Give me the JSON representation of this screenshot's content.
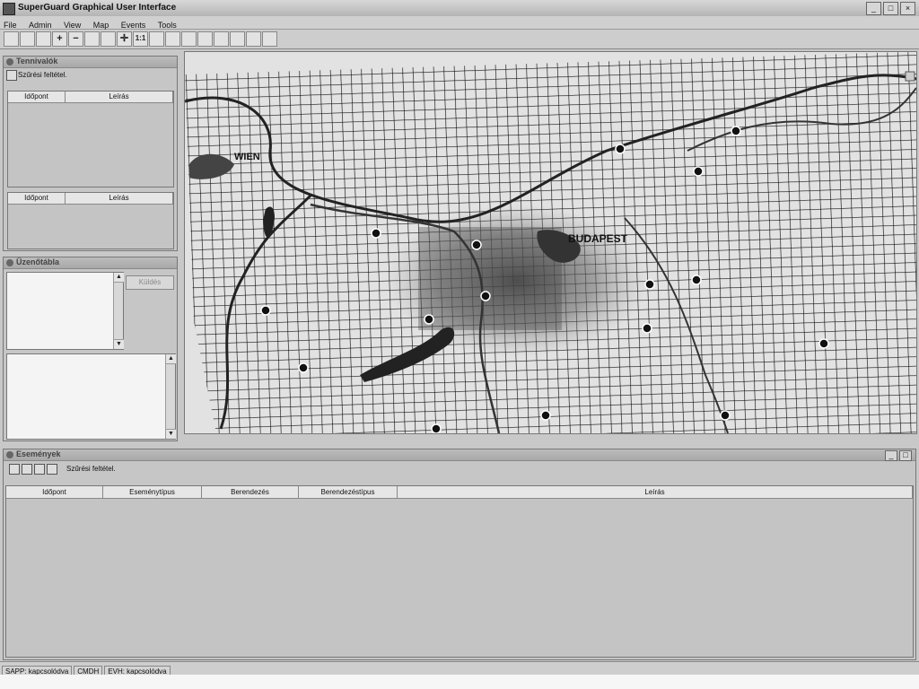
{
  "window": {
    "title": "SuperGuard Graphical User Interface",
    "controls": [
      "_",
      "□",
      "×"
    ]
  },
  "menu": [
    "File",
    "Admin",
    "View",
    "Map",
    "Events",
    "Tools"
  ],
  "toolbar": {
    "icons": [
      "table-icon",
      "table-icon",
      "globe-icon",
      "zoom-in-icon",
      "zoom-out-icon",
      "zoom-area-icon",
      "zoom-rect-icon",
      "pan-icon",
      "one-to-one-icon",
      "magnifier-icon",
      "shape-icon",
      "shape-icon",
      "pencil-icon",
      "marker-icon",
      "layer-icon",
      "tower-icon",
      "tower-icon"
    ],
    "labels": [
      "",
      "",
      "",
      "+",
      "−",
      "",
      "",
      "✛",
      "1:1",
      "",
      "",
      "",
      "",
      "",
      "",
      "",
      ""
    ]
  },
  "tasks": {
    "title": "Tennivalók",
    "filter_label": "Szűrési feltétel.",
    "table1_headers": [
      "Időpont",
      "Leírás"
    ],
    "table2_headers": [
      "Időpont",
      "Leírás"
    ]
  },
  "messages": {
    "title": "Üzenőtábla",
    "send_button": "Küldés"
  },
  "map": {
    "labels": {
      "wien": "WIEN",
      "budapest": "BUDAPEST"
    }
  },
  "events": {
    "title": "Események",
    "filter_label": "Szűrési feltétel.",
    "headers": [
      "Időpont",
      "Eseménytípus",
      "Berendezés",
      "Berendezéstípus",
      "Leírás"
    ]
  },
  "status": [
    "SAPP: kapcsolódva",
    "CMDH",
    "EVH: kapcsolódva"
  ]
}
